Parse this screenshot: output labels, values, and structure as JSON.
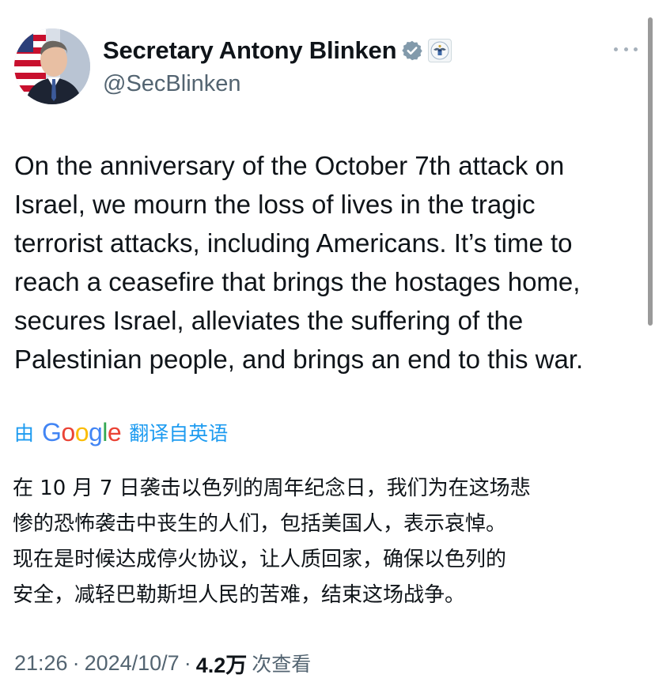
{
  "author": {
    "display_name": "Secretary Antony Blinken",
    "handle": "@SecBlinken",
    "avatar_icon": "profile-photo",
    "verified_icon": "verified-badge-icon",
    "affiliation_icon": "us-state-department-seal-icon"
  },
  "more_icon": "more-options-icon",
  "tweet": {
    "text_en": "On the anniversary of the October 7th attack on\nIsrael, we mourn the loss of lives in the tragic\nterrorist attacks, including Americans. It’s time to\nreach a ceasefire that brings the hostages home,\nsecures Israel, alleviates the suffering of the\nPalestinian people, and brings an end to this war.",
    "translation": {
      "by": "由",
      "provider": "Google",
      "from": "翻译自英语"
    },
    "text_zh": "在 10 月 7 日袭击以色列的周年纪念日，我们为在这场悲\n惨的恐怖袭击中丧生的人们，包括美国人，表示哀悼。\n现在是时候达成停火协议，让人质回家，确保以色列的\n安全，减轻巴勒斯坦人民的苦难，结束这场战争。"
  },
  "meta": {
    "time": "21:26",
    "date": "2024/10/7",
    "views_count": "4.2万",
    "views_label": "次查看",
    "separator": "·"
  },
  "colors": {
    "link": "#1d9bf0",
    "secondary_text": "#536471",
    "primary_text": "#0f1419",
    "verified": "#829aab"
  }
}
